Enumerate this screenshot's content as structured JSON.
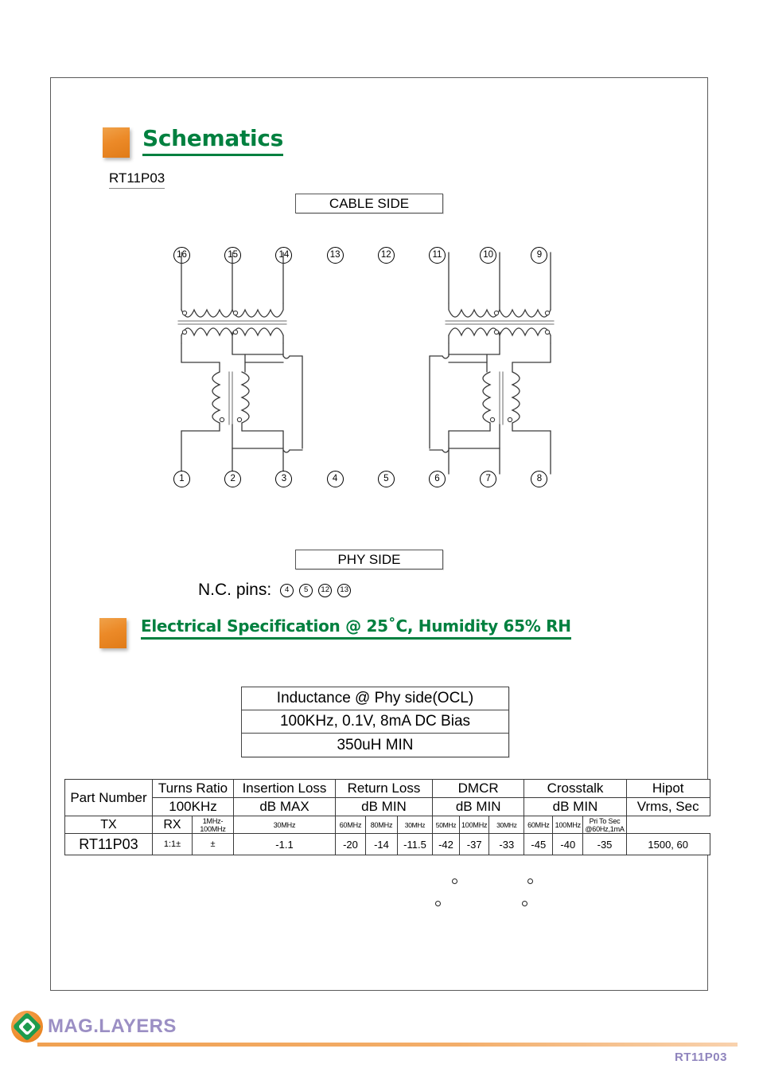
{
  "page": {
    "part_number": "RT11P03",
    "footer_part_number": "RT11P03",
    "brand": "MAG.LAYERS"
  },
  "sections": {
    "schematics": {
      "title": "Schematics",
      "part_label": "RT11P03"
    },
    "electrical": {
      "title": "Electrical Specification @ 25˚C, Humidity 65% RH"
    }
  },
  "schematic": {
    "cable_side_label": "CABLE SIDE",
    "phy_side_label": "PHY SIDE",
    "top_pins": [
      "16",
      "15",
      "14",
      "13",
      "12",
      "11",
      "10",
      "9"
    ],
    "bottom_pins": [
      "1",
      "2",
      "3",
      "4",
      "5",
      "6",
      "7",
      "8"
    ],
    "nc_label": "N.C. pins:",
    "nc_pins": [
      "4",
      "5",
      "12",
      "13"
    ]
  },
  "inductance": {
    "line1": "Inductance @ Phy side(OCL)",
    "line2": "100KHz, 0.1V, 8mA DC Bias",
    "line3": "350uH MIN"
  },
  "spec_table": {
    "group_headers": {
      "part_number": "Part Number",
      "turns_ratio": "Turns Ratio",
      "insertion_loss": "Insertion Loss",
      "return_loss": "Return Loss",
      "dmcr": "DMCR",
      "crosstalk": "Crosstalk",
      "hipot": "Hipot"
    },
    "unit_headers": {
      "turns_ratio": "100KHz",
      "insertion_loss": "dB MAX",
      "return_loss": "dB MIN",
      "dmcr": "dB MIN",
      "crosstalk": "dB MIN",
      "hipot": "Vrms, Sec"
    },
    "condition_headers": {
      "tx": "TX",
      "rx": "RX",
      "insertion_loss_freq": "1MHz-100MHz",
      "return_loss_f1": "30MHz",
      "return_loss_f2": "60MHz",
      "return_loss_f3": "80MHz",
      "dmcr_f1": "30MHz",
      "dmcr_f2": "50MHz",
      "dmcr_f3": "100MHz",
      "crosstalk_f1": "30MHz",
      "crosstalk_f2": "60MHz",
      "crosstalk_f3": "100MHz",
      "hipot_cond": "Pri To Sec @60Hz,1mA"
    },
    "rows": [
      {
        "part_number": "RT11P03",
        "turns_ratio_tx": "1:1±",
        "turns_ratio_rx": "±",
        "insertion_loss": "-1.1",
        "return_loss_30": "-20",
        "return_loss_60": "-14",
        "return_loss_80": "-11.5",
        "dmcr_30": "-42",
        "dmcr_50": "-37",
        "dmcr_100": "-33",
        "crosstalk_30": "-45",
        "crosstalk_60": "-40",
        "crosstalk_100": "-35",
        "hipot": "1500, 60"
      }
    ]
  },
  "colors": {
    "heading_green": "#00803f",
    "accent_orange": "#ec8a28",
    "brand_purple": "#9b8fc4"
  }
}
